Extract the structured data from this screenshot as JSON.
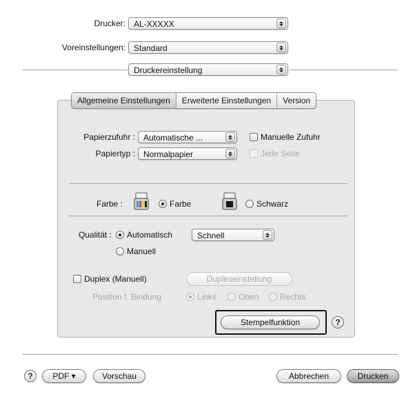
{
  "header": {
    "printer_label": "Drucker:",
    "printer_value": "AL-XXXXX",
    "presets_label": "Voreinstellungen:",
    "presets_value": "Standard",
    "section_value": "Druckereinstellung"
  },
  "tabs": [
    {
      "label": "Allgemeine Einstellungen",
      "selected": true
    },
    {
      "label": "Erweiterte Einstellungen",
      "selected": false
    },
    {
      "label": "Version",
      "selected": false
    }
  ],
  "paper": {
    "source_label": "Papierzufuhr :",
    "source_value": "Automatische ...",
    "manual_feed_label": "Manuelle Zufuhr",
    "type_label": "Papiertyp :",
    "type_value": "Normalpapier",
    "each_page_label": "Jede Seite"
  },
  "color": {
    "label": "Farbe :",
    "option_color": "Farbe",
    "option_black": "Schwarz",
    "selected": "Farbe"
  },
  "quality": {
    "label": "Qualität :",
    "option_auto": "Automatisch",
    "option_manual": "Manuell",
    "speed_value": "Schnell",
    "selected": "Automatisch"
  },
  "duplex": {
    "checkbox_label": "Duplex (Manuell)",
    "settings_button": "Duplexeinstellung",
    "binding_label": "Position f. Bindung",
    "option_left": "Links",
    "option_top": "Oben",
    "option_right": "Rechts",
    "selected": "Links"
  },
  "watermark_button": "Stempelfunktion",
  "help_glyph": "?",
  "footer": {
    "pdf_button": "PDF ▾",
    "preview_button": "Vorschau",
    "cancel_button": "Abbrechen",
    "print_button": "Drucken"
  },
  "colors": {
    "panel_bg": "#e9e9e9",
    "highlight_border": "#111111",
    "disabled_text": "#a8a8a8"
  },
  "icons": [
    "chevron-updown-icon",
    "color-printer-icon",
    "black-printer-icon",
    "help-icon"
  ]
}
